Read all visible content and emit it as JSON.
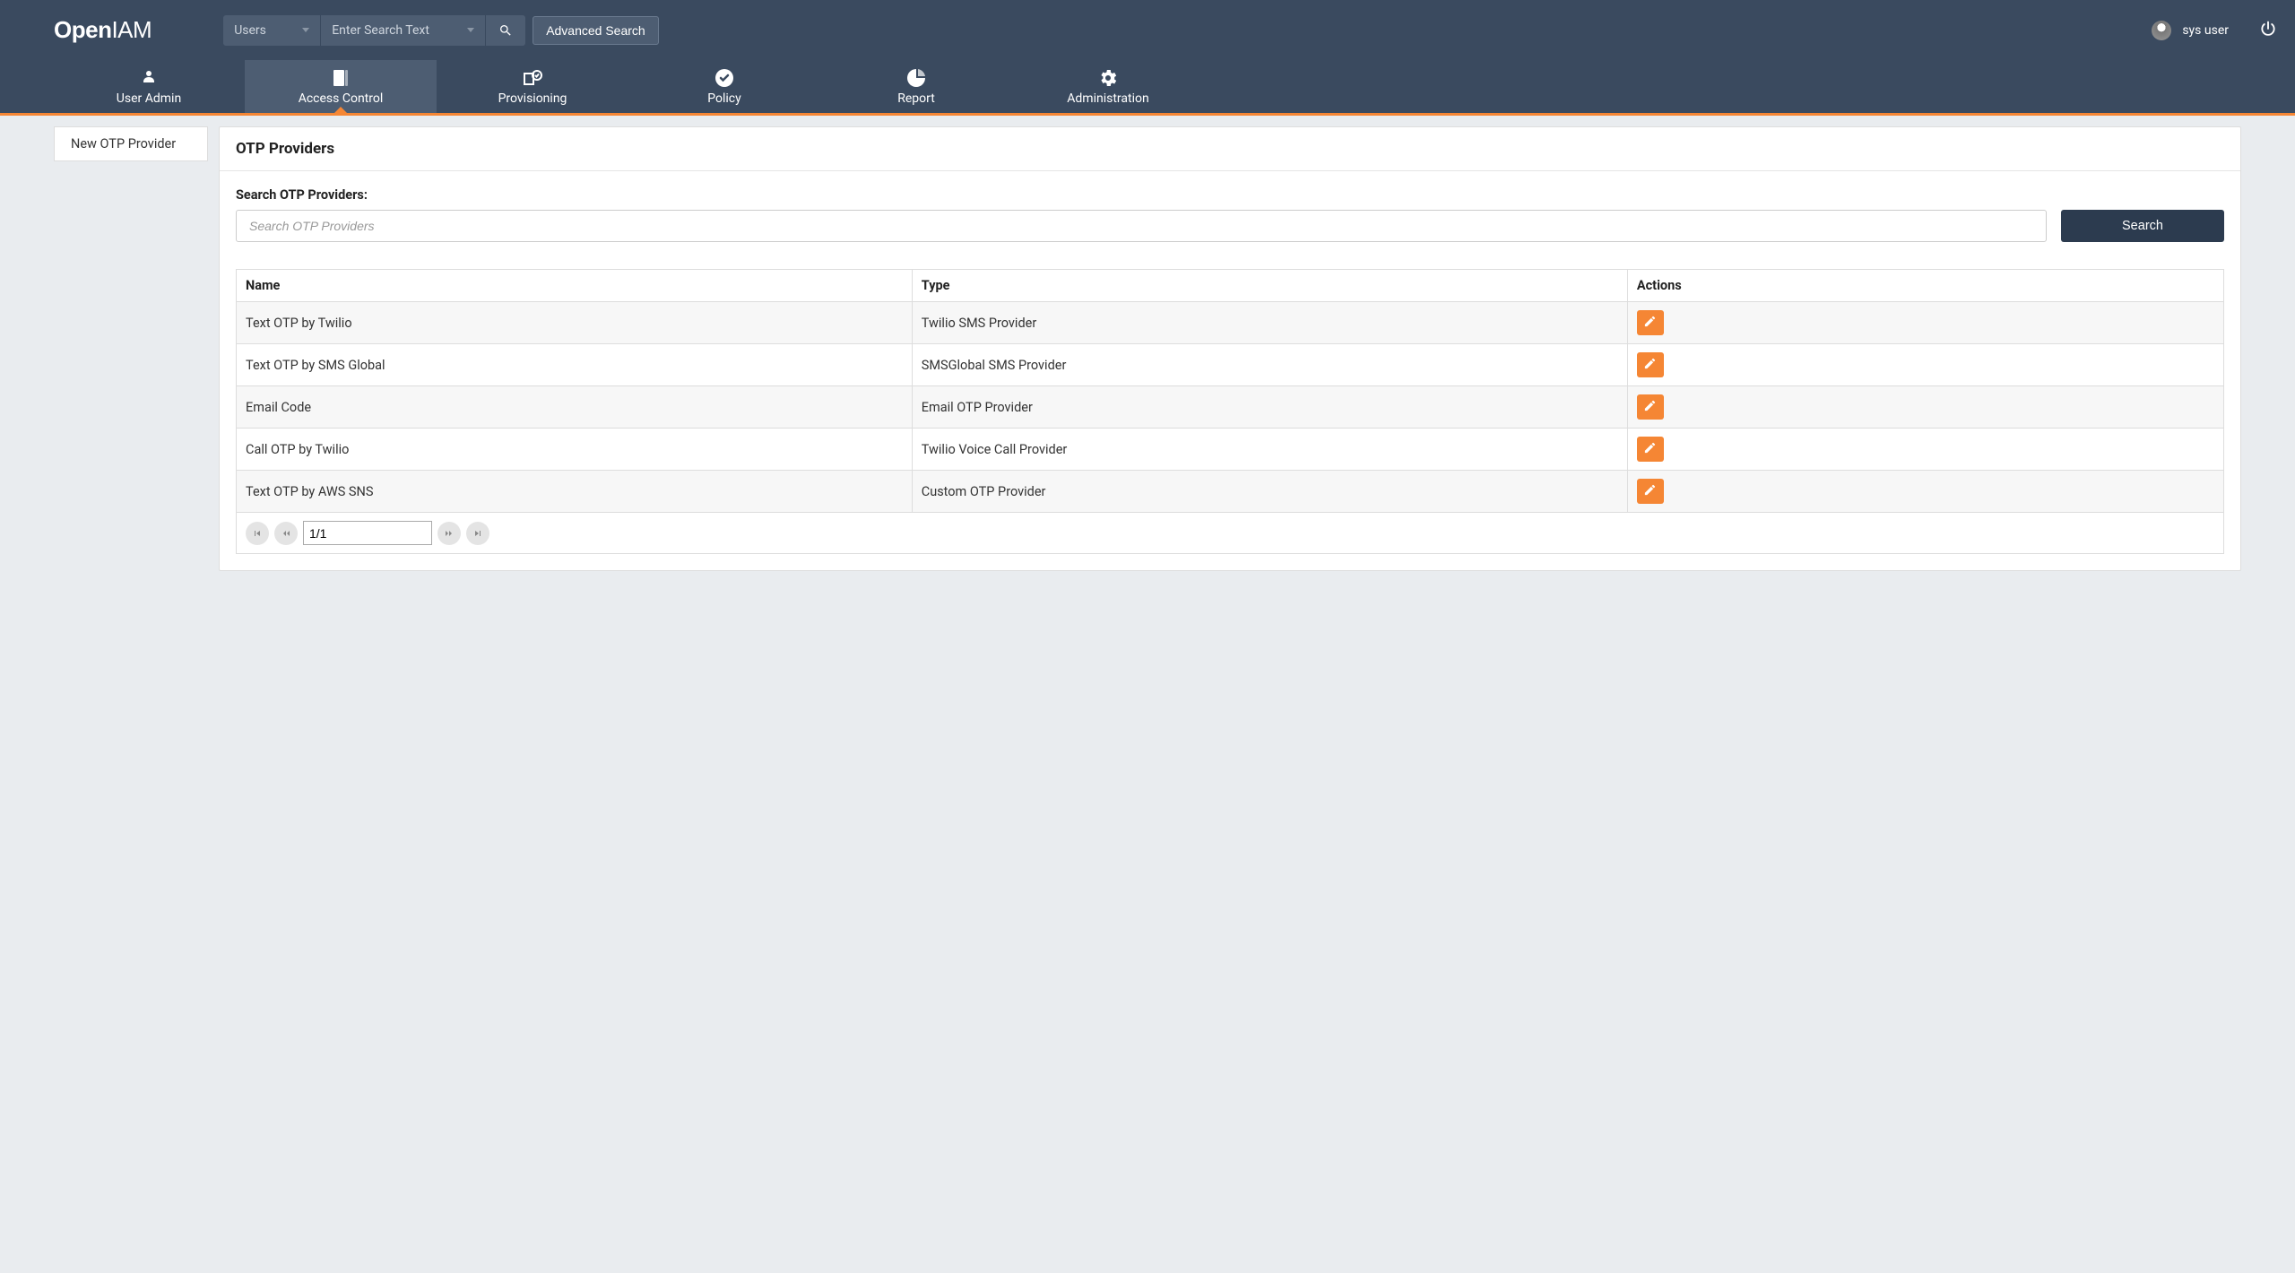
{
  "brand": {
    "open": "Open",
    "iam": "IAM"
  },
  "topSearch": {
    "typeLabel": "Users",
    "placeholder": "Enter Search Text",
    "advanced": "Advanced Search"
  },
  "user": {
    "name": "sys user"
  },
  "nav": {
    "items": [
      {
        "label": "User Admin"
      },
      {
        "label": "Access Control"
      },
      {
        "label": "Provisioning"
      },
      {
        "label": "Policy"
      },
      {
        "label": "Report"
      },
      {
        "label": "Administration"
      }
    ],
    "activeIndex": 1
  },
  "sidebar": {
    "items": [
      {
        "label": "New OTP Provider"
      }
    ]
  },
  "page": {
    "title": "OTP Providers",
    "searchLabel": "Search OTP Providers:",
    "searchPlaceholder": "Search OTP Providers",
    "searchButton": "Search"
  },
  "table": {
    "headers": {
      "name": "Name",
      "type": "Type",
      "actions": "Actions"
    },
    "rows": [
      {
        "name": "Text OTP by Twilio",
        "type": "Twilio SMS Provider"
      },
      {
        "name": "Text OTP by SMS Global",
        "type": "SMSGlobal SMS Provider"
      },
      {
        "name": "Email Code",
        "type": "Email OTP Provider"
      },
      {
        "name": "Call OTP by Twilio",
        "type": "Twilio Voice Call Provider"
      },
      {
        "name": "Text OTP by AWS SNS",
        "type": "Custom OTP Provider"
      }
    ]
  },
  "pager": {
    "value": "1/1"
  }
}
